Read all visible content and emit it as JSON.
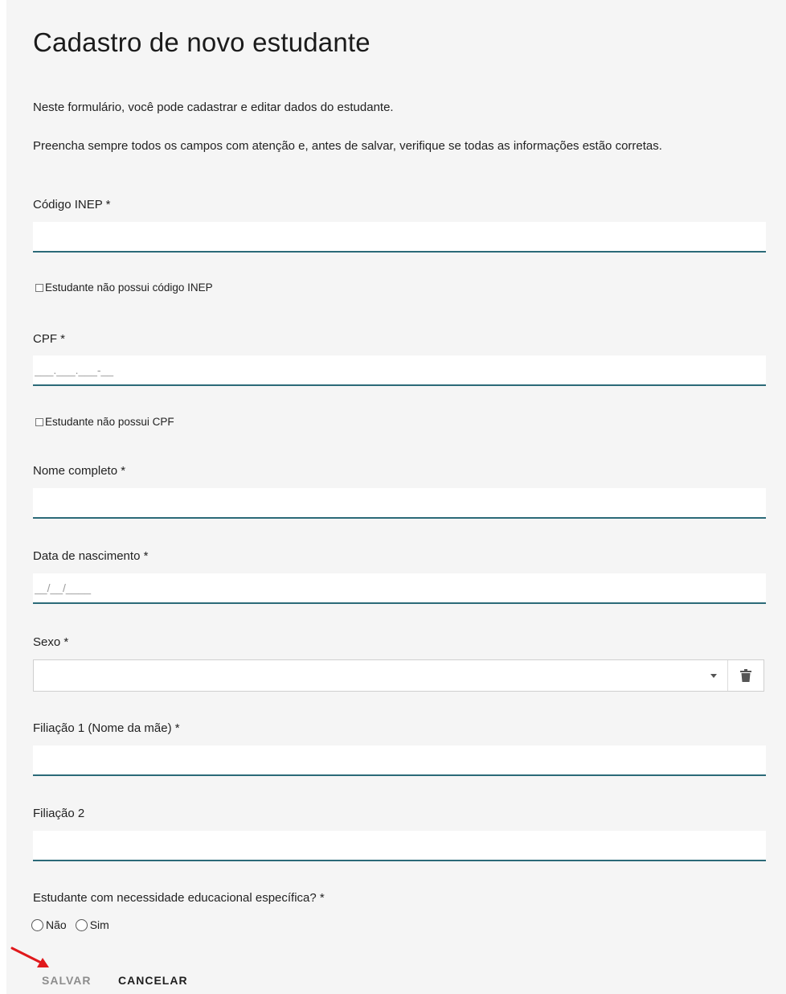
{
  "form": {
    "title": "Cadastro de novo estudante",
    "intro_1": "Neste formulário, você pode cadastrar e editar dados do estudante.",
    "intro_2": "Preencha sempre todos os campos com atenção e, antes de salvar, verifique se todas as informações estão corretas."
  },
  "fields": {
    "inep": {
      "label": "Código INEP *",
      "value": "",
      "placeholder": ""
    },
    "no_inep": {
      "label": "Estudante não possui código INEP",
      "checked": false
    },
    "cpf": {
      "label": "CPF *",
      "value": "",
      "placeholder": "___.___.___-__"
    },
    "no_cpf": {
      "label": "Estudante não possui CPF",
      "checked": false
    },
    "nome": {
      "label": "Nome completo *",
      "value": "",
      "placeholder": ""
    },
    "nascimento": {
      "label": "Data de nascimento *",
      "value": "",
      "placeholder": "__/__/____"
    },
    "sexo": {
      "label": "Sexo *",
      "selected": "",
      "caret_icon": "chevron-down-icon",
      "clear_icon": "trash-icon"
    },
    "filiacao1": {
      "label": "Filiação 1 (Nome da mãe) *",
      "value": "",
      "placeholder": ""
    },
    "filiacao2": {
      "label": "Filiação 2",
      "value": "",
      "placeholder": ""
    },
    "necessidade": {
      "label": "Estudante com necessidade educacional específica? *",
      "options": [
        "Não",
        "Sim"
      ],
      "selected": ""
    }
  },
  "actions": {
    "save_label": "SALVAR",
    "cancel_label": "CANCELAR"
  },
  "annotation": {
    "color": "#e0191c",
    "icon": "arrow-icon"
  },
  "colors": {
    "input_underline": "#2b6a78",
    "background": "#f5f5f5"
  }
}
